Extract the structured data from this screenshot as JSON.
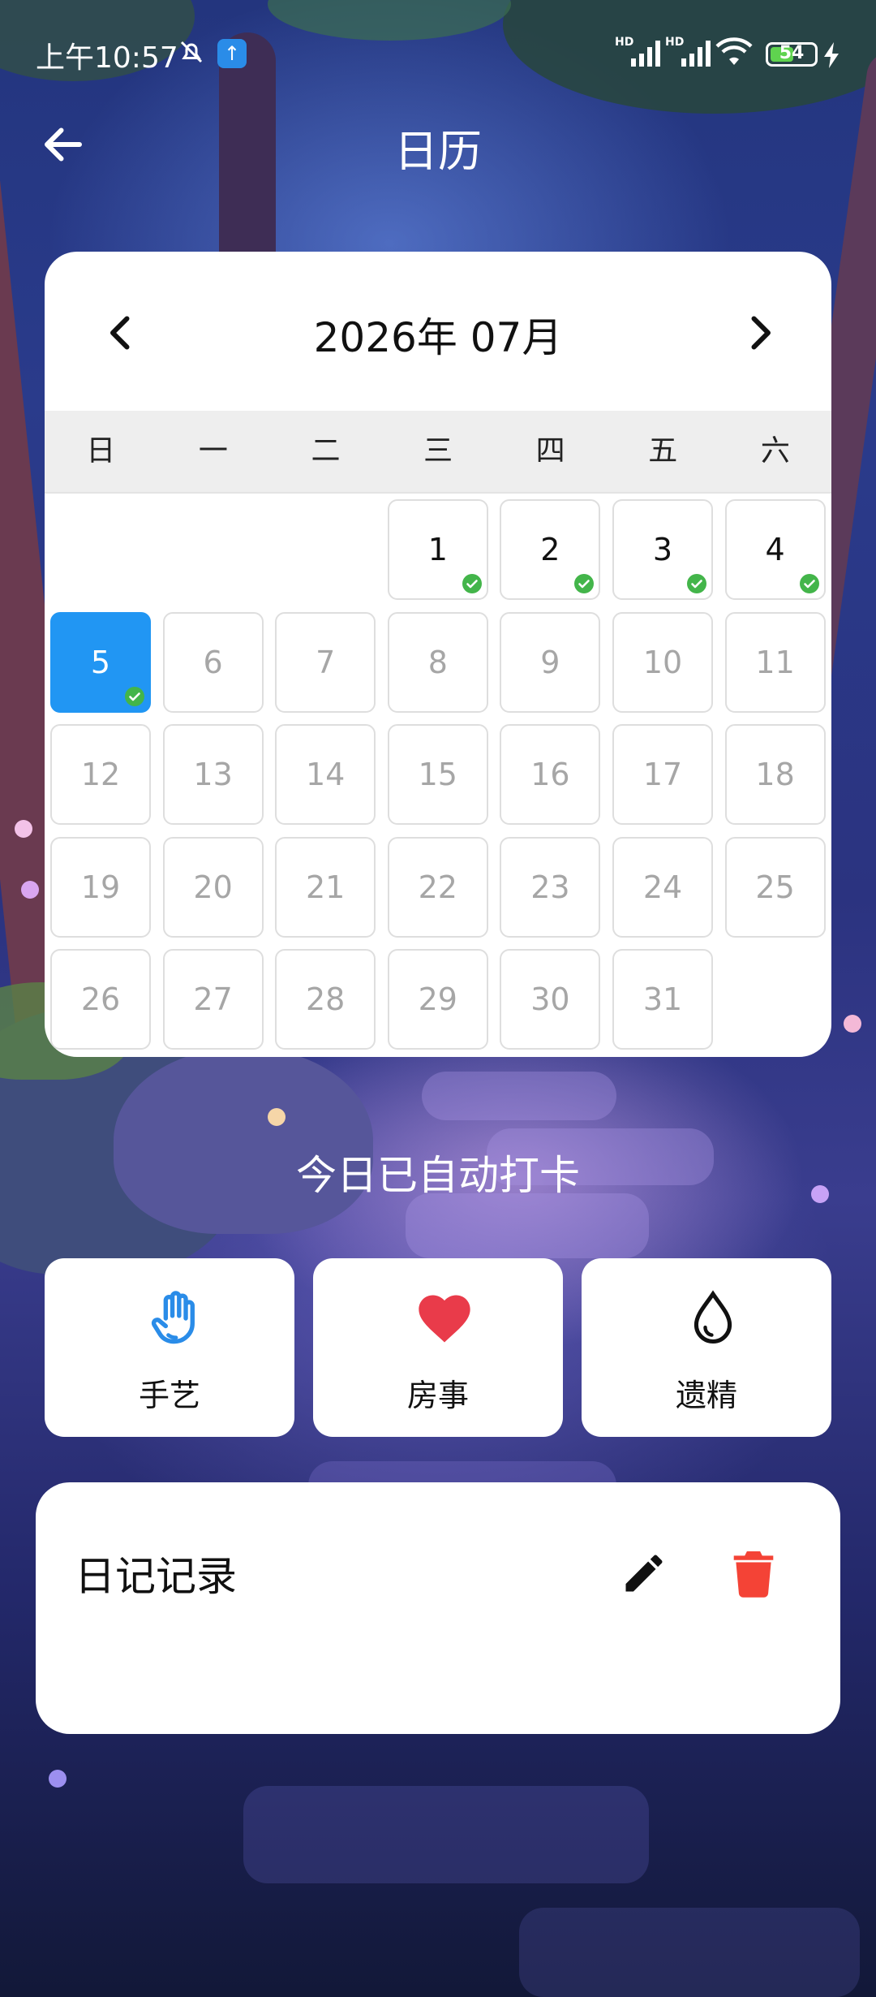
{
  "status_bar": {
    "time": "上午10:57",
    "battery": "54",
    "battery_level": 0.54,
    "network_labels": [
      "HD",
      "HD"
    ]
  },
  "app_bar": {
    "title": "日历"
  },
  "calendar": {
    "month_label": "2026年 07月",
    "weekdays": [
      "日",
      "一",
      "二",
      "三",
      "四",
      "五",
      "六"
    ],
    "first_weekday_index": 3,
    "days_in_month": 31,
    "today": 5,
    "checked_days": [
      1,
      2,
      3,
      4,
      5
    ],
    "colors": {
      "today": "#2196f3",
      "check": "#43b54a"
    }
  },
  "checkin_message": "今日已自动打卡",
  "actions": [
    {
      "label": "手艺",
      "icon": "hand-icon",
      "color": "#2a8ce8"
    },
    {
      "label": "房事",
      "icon": "heart-icon",
      "color": "#e93b4a"
    },
    {
      "label": "遗精",
      "icon": "drop-icon",
      "color": "#111111"
    }
  ],
  "diary": {
    "title": "日记记录",
    "edit_icon": "pencil-icon",
    "delete_icon": "trash-icon",
    "delete_color": "#f44336"
  }
}
